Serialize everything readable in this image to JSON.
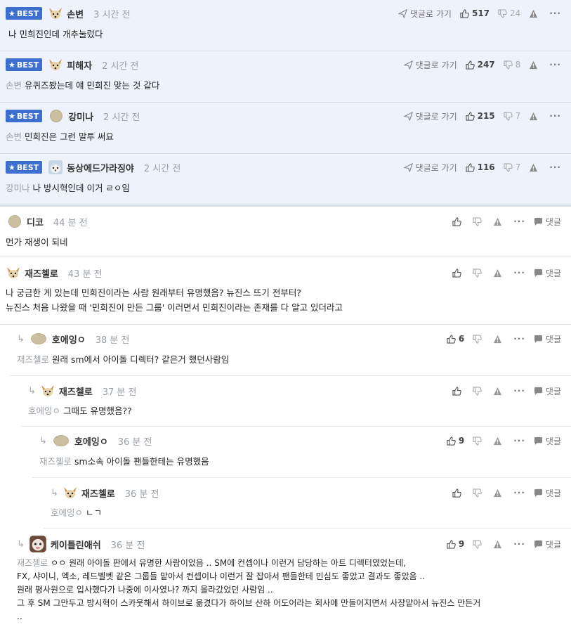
{
  "labels": {
    "best": "BEST",
    "goto_reply": "댓글로 가기",
    "reply": "댓글"
  },
  "best_comments": [
    {
      "nick": "손변",
      "time": "3 시간 전",
      "likes": "517",
      "dislikes": "24",
      "mention": "",
      "text": "나 민희진인데 개추눌렀다",
      "avatar": "dog"
    },
    {
      "nick": "피해자",
      "time": "2 시간 전",
      "likes": "247",
      "dislikes": "8",
      "mention": "손변",
      "text": "유퀴즈봤는데 얘 민희진 맞는 것 같다",
      "avatar": "dog"
    },
    {
      "nick": "강미나",
      "time": "2 시간 전",
      "likes": "215",
      "dislikes": "7",
      "mention": "손변",
      "text": "민희진은 그런 말투 써요",
      "avatar": "blob"
    },
    {
      "nick": "동상에드가라징야",
      "time": "2 시간 전",
      "likes": "116",
      "dislikes": "7",
      "mention": "강미나",
      "text": "나 방시혁인데 이거 ㄹㅇ임",
      "avatar": "pet"
    }
  ],
  "comments": [
    {
      "nick": "디코",
      "time": "44 분 전",
      "likes": "",
      "mention": "",
      "lines": [
        "먼가 재생이 되네"
      ],
      "avatar": "blob"
    },
    {
      "nick": "재즈첼로",
      "time": "43 분 전",
      "likes": "",
      "mention": "",
      "lines": [
        "나 궁금한 게 있는데 민희진이라는 사람 원래부터 유명했음? 뉴진스 뜨기 전부터?",
        "뉴진스 처음 나왔을 때 '민희진이 만든 그룹' 이러면서 민희진이라는 존재를 다 알고 있더라고"
      ],
      "avatar": "dog"
    },
    {
      "nick": "호에잉ㅇ",
      "time": "38 분 전",
      "likes": "6",
      "mention": "재즈첼로",
      "lines": [
        "원래 sm에서 아이돌 디렉터? 같은거 했던사람임"
      ],
      "avatar": "blob"
    },
    {
      "nick": "재즈첼로",
      "time": "37 분 전",
      "likes": "",
      "mention": "호에잉ㅇ",
      "lines": [
        "그때도 유명했음??"
      ],
      "avatar": "dog"
    },
    {
      "nick": "호에잉ㅇ",
      "time": "36 분 전",
      "likes": "9",
      "mention": "재즈첼로",
      "lines": [
        "sm소속 아이돌 팬들한테는 유명했음"
      ],
      "avatar": "blob"
    },
    {
      "nick": "재즈첼로",
      "time": "36 분 전",
      "likes": "",
      "mention": "호에잉ㅇ",
      "lines": [
        "ㄴㄱ"
      ],
      "avatar": "dog"
    },
    {
      "nick": "케이틀린애쉬",
      "time": "36 분 전",
      "likes": "9",
      "mention": "재즈첼로",
      "lines": [
        "ㅇㅇ 원래 아이돌 판에서 유명한 사람이었음 .. SM에 컨셉이나 이런거 담당하는 아트 디렉터였었는데,",
        "FX, 샤이니, 엑소, 레드벨벳 같은 그룹들 맡아서 컨셉이나 이런거 잘 잡아서 팬들한테 민심도 좋았고 결과도 좋았음 ..",
        "원래 평사원으로 입사했다가 나중에 이사였나? 까지 올라갔었던 사람임 ..",
        "그 후 SM 그만두고 방시혁이 스카웃해서 하이브로 옮겼다가 하이브 산하 어도어라는 회사에 만들어지면서 사장맡아서 뉴진스 만든거",
        ".."
      ],
      "avatar": "cat"
    }
  ]
}
